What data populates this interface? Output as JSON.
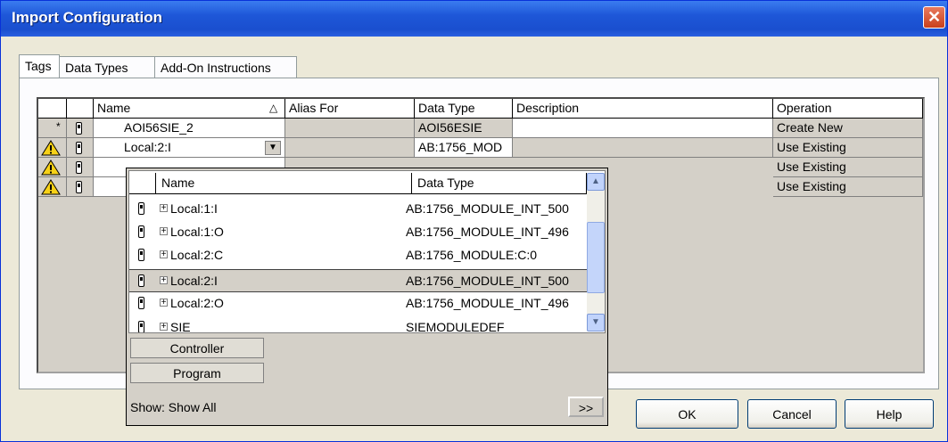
{
  "window": {
    "title": "Import Configuration",
    "close_glyph": "✕"
  },
  "tabs": [
    {
      "label": "Tags",
      "active": true
    },
    {
      "label": "Data Types",
      "active": false
    },
    {
      "label": "Add-On Instructions",
      "active": false
    }
  ],
  "grid": {
    "columns": [
      "Name",
      "Alias For",
      "Data Type",
      "Description",
      "Operation"
    ],
    "sort_glyph": "△",
    "rows": [
      {
        "marker": "*",
        "name": "AOI56SIE_2",
        "alias": "",
        "data_type": "AOI56ESIE",
        "description": "",
        "operation": "Create New"
      },
      {
        "marker": "warning",
        "name": "Local:2:I",
        "alias": "",
        "data_type": "AB:1756_MOD",
        "description": "",
        "operation": "Use Existing"
      },
      {
        "marker": "warning",
        "name": "",
        "alias": "",
        "data_type": "",
        "description": "",
        "operation": "Use Existing"
      },
      {
        "marker": "warning",
        "name": "",
        "alias": "",
        "data_type": "",
        "description": "",
        "operation": "Use Existing"
      }
    ]
  },
  "tag_browser": {
    "columns": [
      "Name",
      "Data Type"
    ],
    "items": [
      {
        "name": "Local:1:I",
        "data_type": "AB:1756_MODULE_INT_500",
        "selected": false
      },
      {
        "name": "Local:1:O",
        "data_type": "AB:1756_MODULE_INT_496",
        "selected": false
      },
      {
        "name": "Local:2:C",
        "data_type": "AB:1756_MODULE:C:0",
        "selected": false
      },
      {
        "name": "Local:2:I",
        "data_type": "AB:1756_MODULE_INT_500",
        "selected": true
      },
      {
        "name": "Local:2:O",
        "data_type": "AB:1756_MODULE_INT_496",
        "selected": false
      },
      {
        "name": "SIE",
        "data_type": "SIEMODULEDEF",
        "selected": false
      }
    ],
    "scope_buttons": [
      "Controller",
      "Program"
    ],
    "show_label": "Show: Show All",
    "more_button": ">>"
  },
  "buttons": {
    "ok": "OK",
    "cancel": "Cancel",
    "help": "Help"
  },
  "colors": {
    "title_bar": "#1e57d8",
    "selection": "#d4d0c8",
    "close": "#c9401c"
  }
}
